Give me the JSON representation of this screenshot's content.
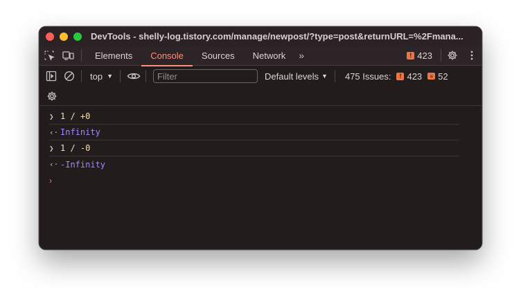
{
  "window": {
    "title": "DevTools - shelly-log.tistory.com/manage/newpost/?type=post&returnURL=%2Fmana..."
  },
  "tabs": [
    {
      "label": "Elements"
    },
    {
      "label": "Console",
      "active": true
    },
    {
      "label": "Sources"
    },
    {
      "label": "Network"
    }
  ],
  "tabbar": {
    "more_tabs": "»",
    "error_count": "423"
  },
  "toolbar": {
    "context": "top",
    "filter_placeholder": "Filter",
    "filter_value": "",
    "levels": "Default levels",
    "issues_label": "475 Issues:",
    "issues_errors": "423",
    "issues_warnings": "52"
  },
  "console": {
    "lines": [
      {
        "kind": "input",
        "text": "1 / +0"
      },
      {
        "kind": "output",
        "text": "Infinity"
      },
      {
        "kind": "input",
        "text": "1 / -0"
      },
      {
        "kind": "output",
        "text": "-Infinity"
      }
    ],
    "prompt": "›"
  },
  "colors": {
    "background": "#221c1d",
    "accent": "#ff8e7e",
    "error": "#f1733f",
    "input_text": "#f4e0b0",
    "output_value": "#a785ff"
  }
}
